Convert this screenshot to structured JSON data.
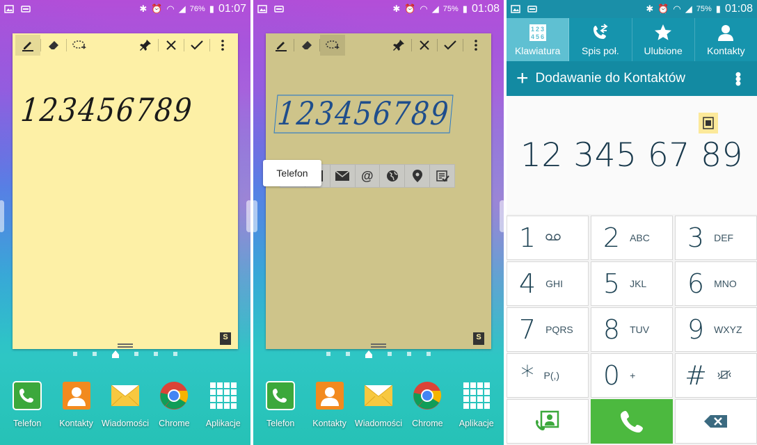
{
  "screen1": {
    "status": {
      "battery": "76%",
      "time": "01:07"
    },
    "memo": {
      "handwriting": "123456789"
    }
  },
  "screen2": {
    "status": {
      "battery": "75%",
      "time": "01:08"
    },
    "memo": {
      "handwriting": "123456789"
    },
    "tooltip": "Telefon"
  },
  "dock": {
    "items": [
      {
        "label": "Telefon",
        "icon": "phone-app-icon"
      },
      {
        "label": "Kontakty",
        "icon": "contacts-app-icon"
      },
      {
        "label": "Wiadomości",
        "icon": "messages-app-icon"
      },
      {
        "label": "Chrome",
        "icon": "chrome-app-icon"
      },
      {
        "label": "Aplikacje",
        "icon": "apps-grid-icon"
      }
    ]
  },
  "screen3": {
    "status": {
      "battery": "75%",
      "time": "01:08"
    },
    "tabs": [
      {
        "label": "Klawiatura",
        "icon": "keypad-icon",
        "active": true
      },
      {
        "label": "Spis poł.",
        "icon": "call-log-icon",
        "active": false
      },
      {
        "label": "Ulubione",
        "icon": "star-icon",
        "active": false
      },
      {
        "label": "Kontakty",
        "icon": "person-icon",
        "active": false
      }
    ],
    "add_contact": "Dodawanie do Kontaktów",
    "dialed_number": "12 345 67 89",
    "keys": [
      {
        "digit": "1",
        "letters": ""
      },
      {
        "digit": "2",
        "letters": "ABC"
      },
      {
        "digit": "3",
        "letters": "DEF"
      },
      {
        "digit": "4",
        "letters": "GHI"
      },
      {
        "digit": "5",
        "letters": "JKL"
      },
      {
        "digit": "6",
        "letters": "MNO"
      },
      {
        "digit": "7",
        "letters": "PQRS"
      },
      {
        "digit": "8",
        "letters": "TUV"
      },
      {
        "digit": "9",
        "letters": "WXYZ"
      },
      {
        "digit": "*",
        "letters": "P(,)"
      },
      {
        "digit": "0",
        "letters": "+"
      },
      {
        "digit": "#",
        "letters": ""
      }
    ]
  },
  "colors": {
    "memo_yellow": "#fdf0a6",
    "dialer_teal": "#1694ad",
    "call_green": "#4cb93f"
  }
}
